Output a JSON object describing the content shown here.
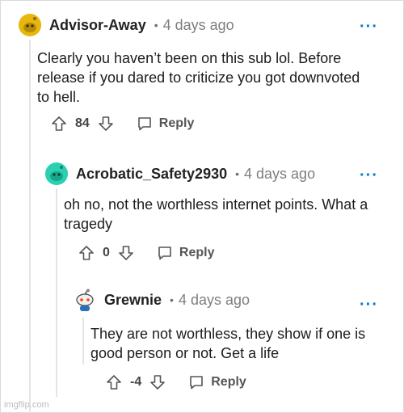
{
  "comments": [
    {
      "username": "Advisor-Away",
      "separator": "•",
      "time": "4 days ago",
      "more_label": "···",
      "body": "Clearly you haven’t been on this sub lol. Before release if you dared to criticize you got downvoted to hell.",
      "score": "84",
      "reply_label": "Reply",
      "avatar_icon": "snoo-avatar-yellow",
      "avatar_color": "#e8b60d"
    },
    {
      "username": "Acrobatic_Safety2930",
      "separator": "•",
      "time": "4 days ago",
      "more_label": "···",
      "body": "oh no, not the worthless internet points. What a tragedy",
      "score": "0",
      "reply_label": "Reply",
      "avatar_icon": "snoo-avatar-teal",
      "avatar_color": "#2ad0b0"
    },
    {
      "username": "Grewnie",
      "separator": "•",
      "time": "4 days ago",
      "more_label": "···",
      "body": "They are not worthless, they show if one is good person or not. Get a life",
      "score": "-4",
      "reply_label": "Reply",
      "avatar_icon": "snoo-avatar-custom",
      "avatar_color": "#ffffff"
    }
  ],
  "colors": {
    "accent": "#0079d3",
    "thread_line": "#e2e4e6"
  },
  "watermark": "imgflip.com"
}
